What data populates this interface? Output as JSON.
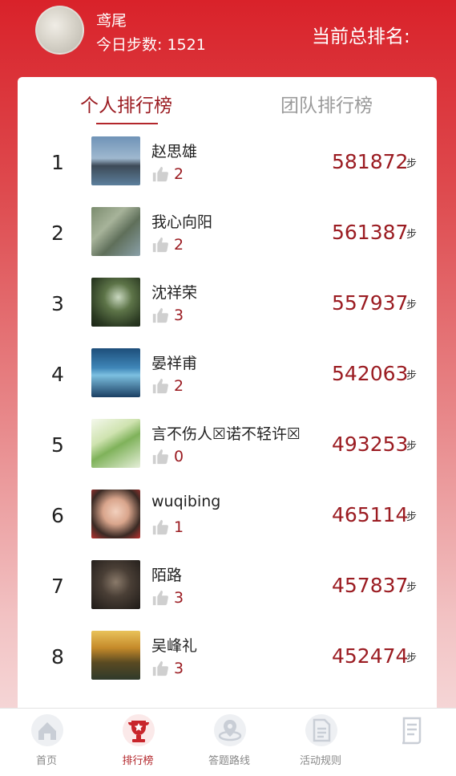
{
  "user": {
    "name": "鸢尾",
    "steps_label": "今日步数: 1521"
  },
  "rank_title": "当前总排名:",
  "tabs": [
    {
      "label": "个人排行榜",
      "active": true
    },
    {
      "label": "团队排行榜",
      "active": false
    }
  ],
  "leaderboard": [
    {
      "rank": "1",
      "name": "赵思雄",
      "likes": "2",
      "steps": "581872",
      "unit": "步"
    },
    {
      "rank": "2",
      "name": "我心向阳",
      "likes": "2",
      "steps": "561387",
      "unit": "步"
    },
    {
      "rank": "3",
      "name": "沈祥荣",
      "likes": "3",
      "steps": "557937",
      "unit": "步"
    },
    {
      "rank": "4",
      "name": "晏祥甫",
      "likes": "2",
      "steps": "542063",
      "unit": "步"
    },
    {
      "rank": "5",
      "name": "言不伤人☒诺不轻许☒",
      "likes": "0",
      "steps": "493253",
      "unit": "步"
    },
    {
      "rank": "6",
      "name": "wuqibing",
      "likes": "1",
      "steps": "465114",
      "unit": "步"
    },
    {
      "rank": "7",
      "name": "陌路",
      "likes": "3",
      "steps": "457837",
      "unit": "步"
    },
    {
      "rank": "8",
      "name": "吴峰礼",
      "likes": "3",
      "steps": "452474",
      "unit": "步"
    }
  ],
  "nav": [
    {
      "label": "首页",
      "icon": "home-icon",
      "active": false
    },
    {
      "label": "排行榜",
      "icon": "trophy-icon",
      "active": true
    },
    {
      "label": "答题路线",
      "icon": "route-icon",
      "active": false
    },
    {
      "label": "活动规则",
      "icon": "document-icon",
      "active": false
    },
    {
      "label": "",
      "icon": "scroll-icon",
      "active": false
    }
  ],
  "colors": {
    "brand_red": "#d9222a",
    "accent_dark_red": "#9b1c22",
    "inactive_gray": "#9a9a9a"
  }
}
